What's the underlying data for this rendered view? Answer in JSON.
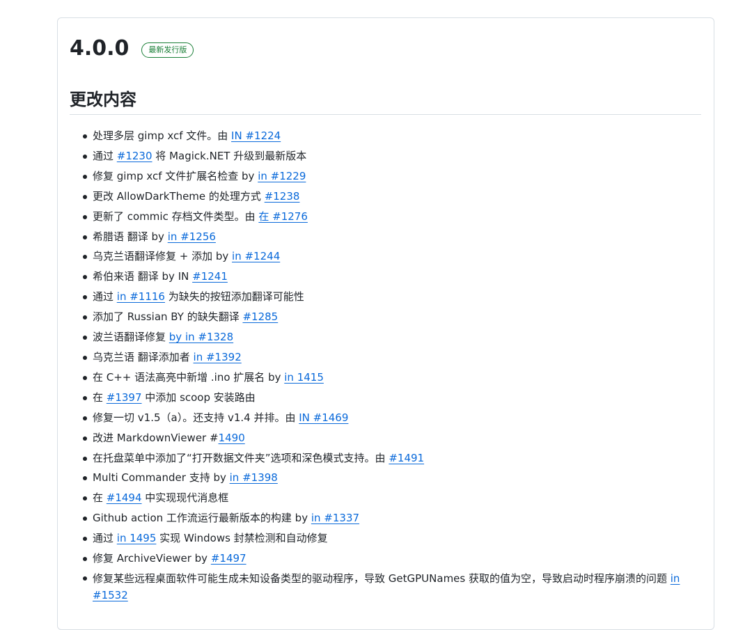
{
  "release": {
    "version": "4.0.0",
    "badge": "最新发行版"
  },
  "section": {
    "heading": "更改内容"
  },
  "items": [
    {
      "before": "处理多层 gimp xcf 文件。由 ",
      "link": "IN #1224",
      "after": ""
    },
    {
      "before": "通过 ",
      "link": "#1230",
      "after": " 将 Magick.NET 升级到最新版本"
    },
    {
      "before": "修复 gimp xcf 文件扩展名检查 by ",
      "link": "in #1229",
      "after": ""
    },
    {
      "before": "更改 AllowDarkTheme 的处理方式 ",
      "link": "#1238",
      "after": ""
    },
    {
      "before": "更新了 commic 存档文件类型。由 ",
      "link": "在 #1276",
      "after": ""
    },
    {
      "before": "希腊语 翻译 by ",
      "link": "in #1256",
      "after": ""
    },
    {
      "before": "乌克兰语翻译修复 + 添加 by ",
      "link": "in #1244",
      "after": ""
    },
    {
      "before": "希伯来语 翻译 by IN ",
      "link": "#1241",
      "after": ""
    },
    {
      "before": "通过 ",
      "link": "in #1116",
      "after": " 为缺失的按钮添加翻译可能性"
    },
    {
      "before": "添加了 Russian BY 的缺失翻译 ",
      "link": "#1285",
      "after": ""
    },
    {
      "before": "波兰语翻译修复 ",
      "link": "by in #1328",
      "after": ""
    },
    {
      "before": "乌克兰语 翻译添加者 ",
      "link": "in #1392",
      "after": ""
    },
    {
      "before": "在 C++ 语法高亮中新增 .ino 扩展名 by ",
      "link": "in 1415",
      "after": ""
    },
    {
      "before": "在 ",
      "link": "#1397",
      "after": " 中添加 scoop 安装路由"
    },
    {
      "before": "修复一切 v1.5（a）。还支持 v1.4 并排。由 ",
      "link": "IN #1469",
      "after": ""
    },
    {
      "before": "改进 MarkdownViewer #",
      "link": "1490",
      "after": ""
    },
    {
      "before": "在托盘菜单中添加了“打开数据文件夹”选项和深色模式支持。由 ",
      "link": "#1491",
      "after": ""
    },
    {
      "before": "Multi Commander 支持 by ",
      "link": "in #1398",
      "after": ""
    },
    {
      "before": "在 ",
      "link": "#1494",
      "after": " 中实现现代消息框"
    },
    {
      "before": "Github action 工作流运行最新版本的构建 by ",
      "link": "in #1337",
      "after": ""
    },
    {
      "before": "通过 ",
      "link": "in 1495",
      "after": " 实现 Windows 封禁检测和自动修复"
    },
    {
      "before": "修复 ArchiveViewer by ",
      "link": "#1497",
      "after": ""
    },
    {
      "before": "修复某些远程桌面软件可能生成未知设备类型的驱动程序，导致 GetGPUNames 获取的值为空，导致启动时程序崩溃的问题 ",
      "link": "in #1532",
      "after": ""
    }
  ]
}
